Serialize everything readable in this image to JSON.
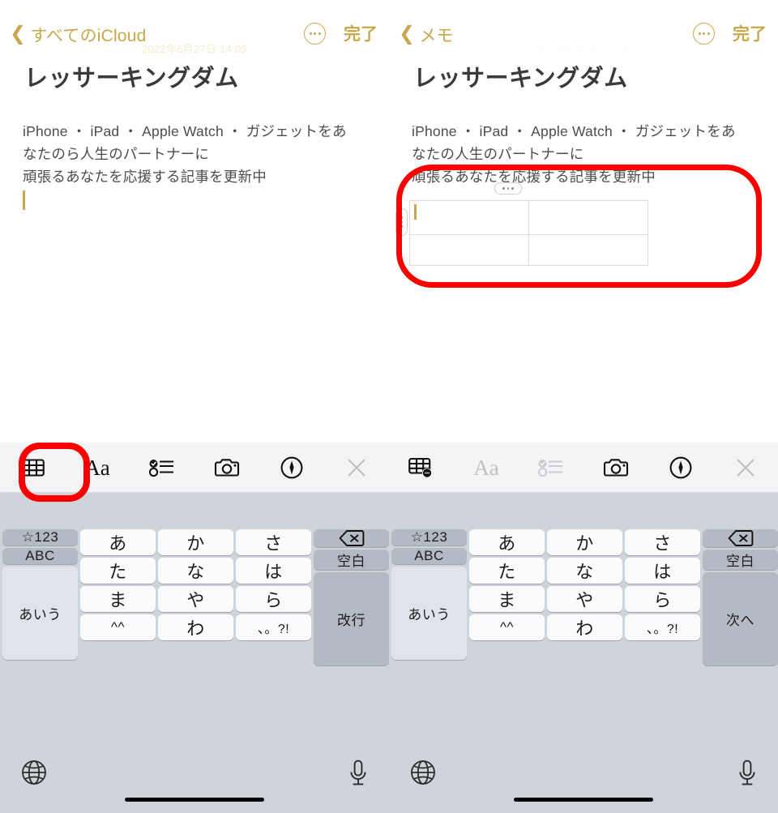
{
  "meta": {
    "app": "Notes",
    "accent_gold": "#c9a84c",
    "annotation_color": "#fb0000",
    "toolbar_bg": "#f4f4f6",
    "keyboard_bg": "#cfd3da"
  },
  "panels": [
    {
      "id": "left",
      "nav": {
        "back_label": "すべてのiCloud",
        "back_icon": "chevron-left-icon",
        "date": "2022年6月27日 14:09",
        "more_icon": "more-ellipsis-icon",
        "done_label": "完了"
      },
      "note": {
        "title": "レッサーキングダム",
        "body_lines": [
          "iPhone ・ iPad ・ Apple Watch ・ ガジェットをあ",
          "なたのら人生のパートナーに",
          "頑張るあなたを応援する記事を更新中"
        ],
        "caret_visible": true
      },
      "format_toolbar": {
        "buttons": [
          {
            "name": "table-icon",
            "label": "表",
            "state": "active",
            "highlighted": true
          },
          {
            "name": "text-format-icon",
            "label": "Aa",
            "state": "active",
            "highlighted": false
          },
          {
            "name": "checklist-icon",
            "label": "チェックリスト",
            "state": "active",
            "highlighted": false
          },
          {
            "name": "camera-icon",
            "label": "カメラ",
            "state": "active",
            "highlighted": false
          },
          {
            "name": "markup-pen-icon",
            "label": "マークアップ",
            "state": "active",
            "highlighted": false
          },
          {
            "name": "close-icon",
            "label": "閉じる",
            "state": "dimmed",
            "highlighted": false
          }
        ]
      },
      "keyboard": {
        "rows": [
          [
            {
              "label": "☆123",
              "type": "fn",
              "size": "small"
            },
            {
              "label": "あ",
              "type": "char"
            },
            {
              "label": "か",
              "type": "char"
            },
            {
              "label": "さ",
              "type": "char"
            },
            {
              "label": "⌫",
              "type": "fn",
              "icon": "delete-backward-icon"
            }
          ],
          [
            {
              "label": "ABC",
              "type": "fn",
              "size": "small"
            },
            {
              "label": "た",
              "type": "char"
            },
            {
              "label": "な",
              "type": "char"
            },
            {
              "label": "は",
              "type": "char"
            },
            {
              "label": "空白",
              "type": "fn",
              "size": "small"
            }
          ],
          [
            {
              "label": "あいう",
              "type": "fn-light",
              "size": "small"
            },
            {
              "label": "ま",
              "type": "char"
            },
            {
              "label": "や",
              "type": "char"
            },
            {
              "label": "ら",
              "type": "char"
            },
            {
              "label": "改行",
              "type": "fn",
              "size": "small"
            }
          ],
          [
            {
              "label": "^^",
              "type": "char",
              "size": "small"
            },
            {
              "label": "わ",
              "type": "char"
            },
            {
              "label": "、。?!",
              "type": "char",
              "size": "tiny"
            }
          ]
        ],
        "bottom": {
          "globe_icon": "globe-icon",
          "mic_icon": "microphone-icon"
        }
      }
    },
    {
      "id": "right",
      "nav": {
        "back_label": "メモ",
        "back_icon": "chevron-left-icon",
        "date": "2022年6月26日 9:10",
        "more_icon": "more-ellipsis-icon",
        "done_label": "完了"
      },
      "note": {
        "title": "レッサーキングダム",
        "body_lines": [
          "iPhone ・ iPad ・ Apple Watch ・ ガジェットをあ",
          "なたの人生のパートナーに",
          "頑張るあなたを応援する記事を更新中"
        ],
        "caret_visible": false,
        "table": {
          "columns": 2,
          "rows": 2,
          "cells": [
            [
              "",
              ""
            ],
            [
              "",
              ""
            ]
          ],
          "active_cell": [
            0,
            0
          ],
          "column_handle_icon": "column-handle-dots-icon",
          "row_handle_icon": "row-handle-dots-icon"
        }
      },
      "format_toolbar": {
        "buttons": [
          {
            "name": "table-options-icon",
            "label": "表オプション",
            "state": "active",
            "highlighted": false
          },
          {
            "name": "text-format-icon",
            "label": "Aa",
            "state": "dimmed",
            "highlighted": false
          },
          {
            "name": "checklist-icon",
            "label": "チェックリスト",
            "state": "dimmed",
            "highlighted": false
          },
          {
            "name": "camera-icon",
            "label": "カメラ",
            "state": "active",
            "highlighted": false
          },
          {
            "name": "markup-pen-icon",
            "label": "マークアップ",
            "state": "active",
            "highlighted": false
          },
          {
            "name": "close-icon",
            "label": "閉じる",
            "state": "dimmed",
            "highlighted": false
          }
        ]
      },
      "keyboard": {
        "rows": [
          [
            {
              "label": "☆123",
              "type": "fn",
              "size": "small"
            },
            {
              "label": "あ",
              "type": "char"
            },
            {
              "label": "か",
              "type": "char"
            },
            {
              "label": "さ",
              "type": "char"
            },
            {
              "label": "⌫",
              "type": "fn",
              "icon": "delete-backward-icon"
            }
          ],
          [
            {
              "label": "ABC",
              "type": "fn",
              "size": "small"
            },
            {
              "label": "た",
              "type": "char"
            },
            {
              "label": "な",
              "type": "char"
            },
            {
              "label": "は",
              "type": "char"
            },
            {
              "label": "空白",
              "type": "fn",
              "size": "small"
            }
          ],
          [
            {
              "label": "あいう",
              "type": "fn-light",
              "size": "small"
            },
            {
              "label": "ま",
              "type": "char"
            },
            {
              "label": "や",
              "type": "char"
            },
            {
              "label": "ら",
              "type": "char"
            },
            {
              "label": "次へ",
              "type": "fn",
              "size": "small"
            }
          ],
          [
            {
              "label": "^^",
              "type": "char",
              "size": "small"
            },
            {
              "label": "わ",
              "type": "char"
            },
            {
              "label": "、。?!",
              "type": "char",
              "size": "tiny"
            }
          ]
        ],
        "bottom": {
          "globe_icon": "globe-icon",
          "mic_icon": "microphone-icon"
        }
      }
    }
  ],
  "annotations": [
    {
      "name": "annotation-circle-table",
      "shape": "rounded-rect",
      "target": "note-table-region"
    },
    {
      "name": "annotation-circle-table-button",
      "shape": "rounded-rect",
      "target": "toolbar-table-button"
    }
  ]
}
